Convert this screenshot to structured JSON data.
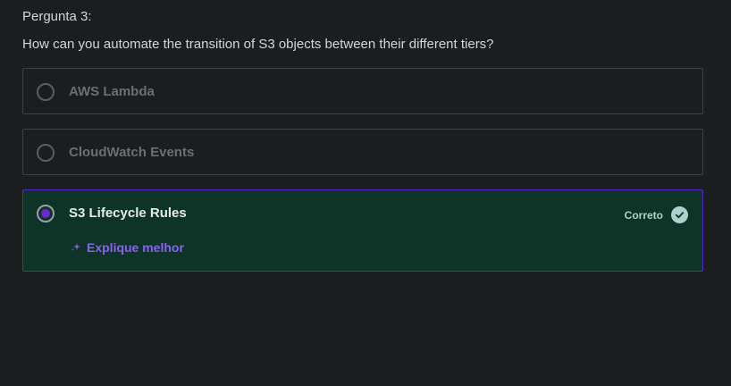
{
  "question": {
    "number_label": "Pergunta 3:",
    "text": "How can you automate the transition of S3 objects between their different tiers?"
  },
  "options": [
    {
      "label": "AWS Lambda",
      "selected": false
    },
    {
      "label": "CloudWatch Events",
      "selected": false
    },
    {
      "label": "S3 Lifecycle Rules",
      "selected": true
    }
  ],
  "result": {
    "status_label": "Correto",
    "explain_label": "Explique melhor"
  },
  "colors": {
    "background": "#1c1d1f",
    "correct_bg": "#0e3428",
    "accent_purple": "#6d28d2",
    "correct_mint": "#acd2cc"
  },
  "icons": {
    "check": "check-circle-icon",
    "explain": "sparkle-icon"
  }
}
